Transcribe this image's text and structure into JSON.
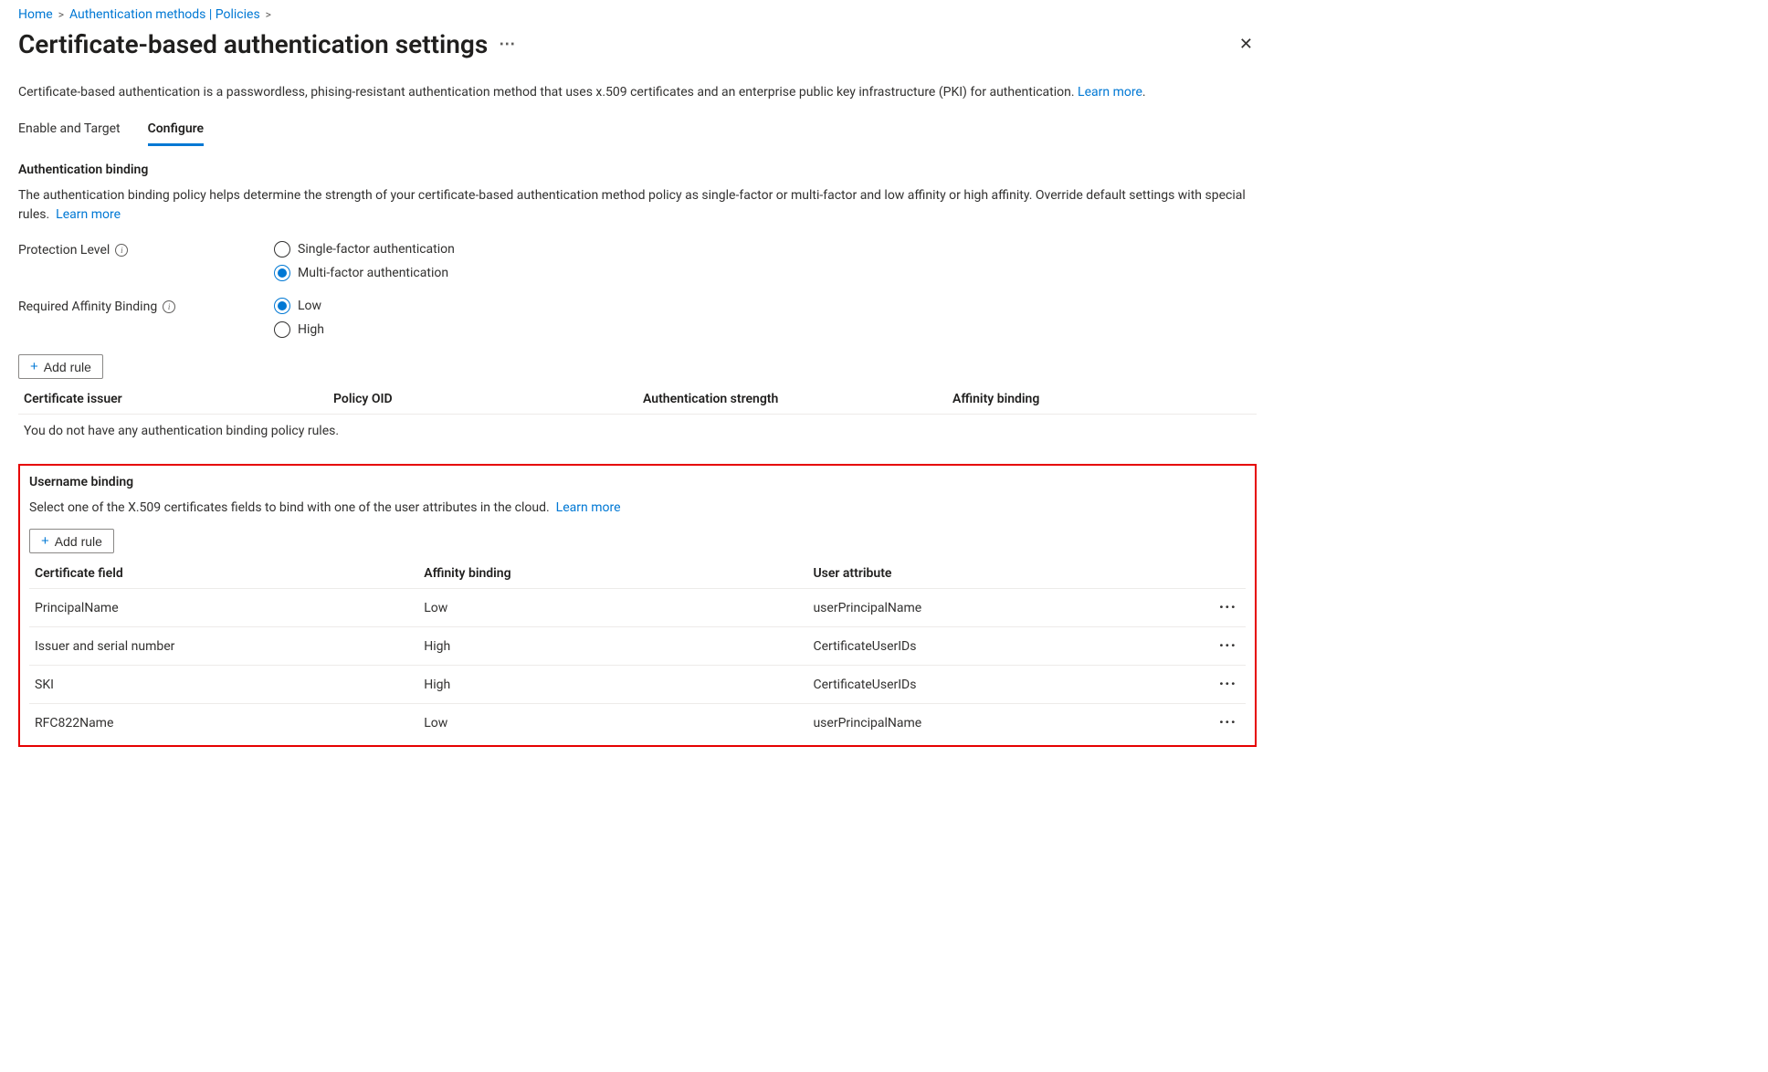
{
  "breadcrumb": {
    "home": "Home",
    "auth_methods": "Authentication methods | Policies"
  },
  "page": {
    "title": "Certificate-based authentication settings",
    "description": "Certificate-based authentication is a passwordless, phising-resistant authentication method that uses x.509 certificates and an enterprise public key infrastructure (PKI) for authentication.",
    "learn_more": "Learn more"
  },
  "tabs": {
    "enable": "Enable and Target",
    "configure": "Configure"
  },
  "auth_binding": {
    "heading": "Authentication binding",
    "description": "The authentication binding policy helps determine the strength of your certificate-based authentication method policy as single-factor or multi-factor and low affinity or high affinity. Override default settings with special rules.",
    "learn_more": "Learn more",
    "protection_label": "Protection Level",
    "protection_options": {
      "single": "Single-factor authentication",
      "multi": "Multi-factor authentication"
    },
    "affinity_label": "Required Affinity Binding",
    "affinity_options": {
      "low": "Low",
      "high": "High"
    },
    "add_rule": "Add rule",
    "columns": {
      "issuer": "Certificate issuer",
      "oid": "Policy OID",
      "strength": "Authentication strength",
      "affinity": "Affinity binding"
    },
    "empty_msg": "You do not have any authentication binding policy rules."
  },
  "username_binding": {
    "heading": "Username binding",
    "description": "Select one of the X.509 certificates fields to bind with one of the user attributes in the cloud.",
    "learn_more": "Learn more",
    "add_rule": "Add rule",
    "columns": {
      "field": "Certificate field",
      "affinity": "Affinity binding",
      "attribute": "User attribute"
    },
    "rows": [
      {
        "field": "PrincipalName",
        "affinity": "Low",
        "attribute": "userPrincipalName"
      },
      {
        "field": "Issuer and serial number",
        "affinity": "High",
        "attribute": "CertificateUserIDs"
      },
      {
        "field": "SKI",
        "affinity": "High",
        "attribute": "CertificateUserIDs"
      },
      {
        "field": "RFC822Name",
        "affinity": "Low",
        "attribute": "userPrincipalName"
      }
    ]
  }
}
